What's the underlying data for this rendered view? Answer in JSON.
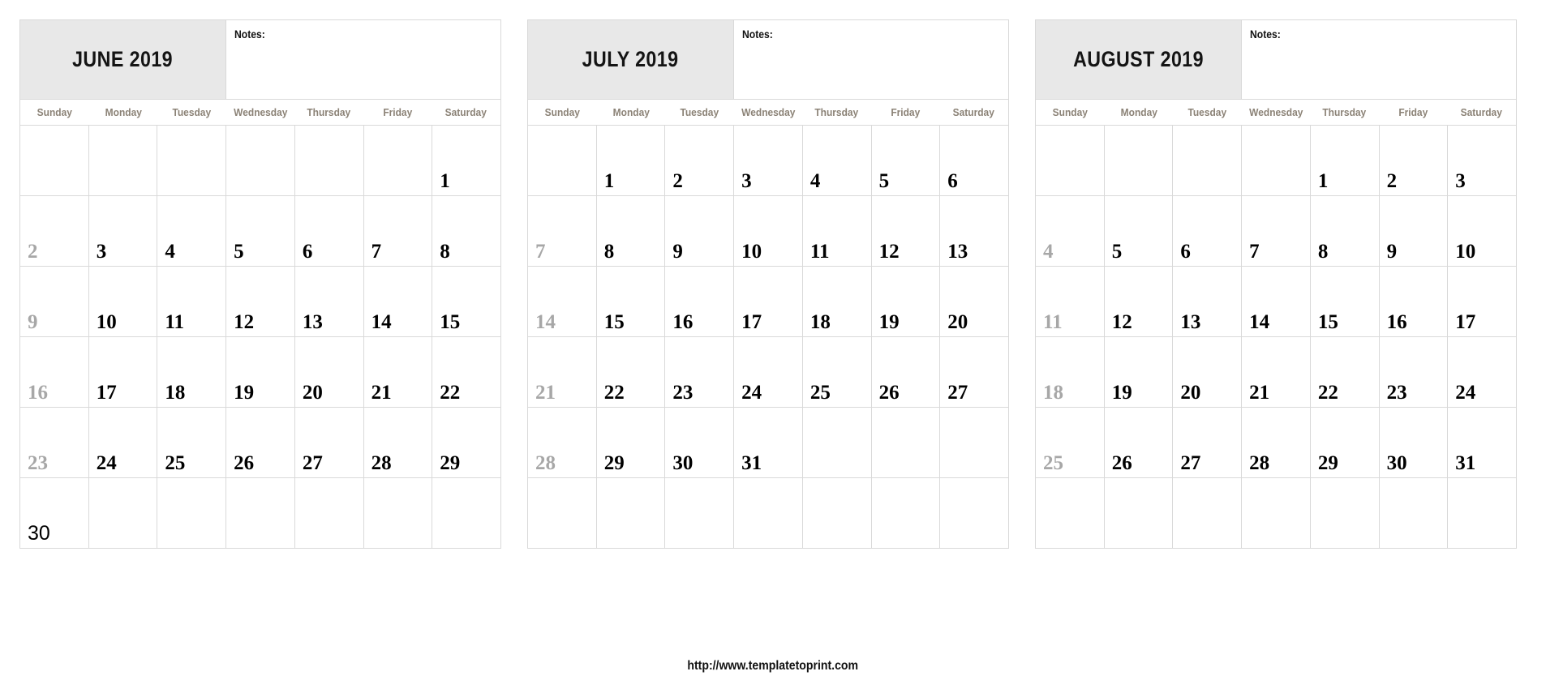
{
  "site": {
    "footer_url": "http://www.templatetoprint.com"
  },
  "labels": {
    "notes": "Notes:"
  },
  "weekdays": [
    "Sunday",
    "Monday",
    "Tuesday",
    "Wednesday",
    "Thursday",
    "Friday",
    "Saturday"
  ],
  "colors": {
    "title_background": "#e8e8e8",
    "grid_border": "#d9d9d9",
    "weekday_text": "#8b8276",
    "sunday_text": "#a7a7a7",
    "weekday_text_dark": "#000000",
    "page_background": "#ffffff"
  },
  "calendars": [
    {
      "id": "june-2019",
      "title": "JUNE 2019",
      "month": "June",
      "year": "2019",
      "notes_value": "",
      "rows": 6,
      "weeks": [
        [
          "",
          "",
          "",
          "",
          "",
          "",
          "1"
        ],
        [
          "2",
          "3",
          "4",
          "5",
          "6",
          "7",
          "8"
        ],
        [
          "9",
          "10",
          "11",
          "12",
          "13",
          "14",
          "15"
        ],
        [
          "16",
          "17",
          "18",
          "19",
          "20",
          "21",
          "22"
        ],
        [
          "23",
          "24",
          "25",
          "26",
          "27",
          "28",
          "29"
        ],
        [
          "30",
          "",
          "",
          "",
          "",
          "",
          ""
        ]
      ]
    },
    {
      "id": "july-2019",
      "title": "JULY 2019",
      "month": "July",
      "year": "2019",
      "notes_value": "",
      "rows": 6,
      "weeks": [
        [
          "",
          "1",
          "2",
          "3",
          "4",
          "5",
          "6"
        ],
        [
          "7",
          "8",
          "9",
          "10",
          "11",
          "12",
          "13"
        ],
        [
          "14",
          "15",
          "16",
          "17",
          "18",
          "19",
          "20"
        ],
        [
          "21",
          "22",
          "23",
          "24",
          "25",
          "26",
          "27"
        ],
        [
          "28",
          "29",
          "30",
          "31",
          "",
          "",
          ""
        ],
        [
          "",
          "",
          "",
          "",
          "",
          "",
          ""
        ]
      ]
    },
    {
      "id": "august-2019",
      "title": "AUGUST 2019",
      "month": "August",
      "year": "2019",
      "notes_value": "",
      "rows": 6,
      "weeks": [
        [
          "",
          "",
          "",
          "",
          "1",
          "2",
          "3"
        ],
        [
          "4",
          "5",
          "6",
          "7",
          "8",
          "9",
          "10"
        ],
        [
          "11",
          "12",
          "13",
          "14",
          "15",
          "16",
          "17"
        ],
        [
          "18",
          "19",
          "20",
          "21",
          "22",
          "23",
          "24"
        ],
        [
          "25",
          "26",
          "27",
          "28",
          "29",
          "30",
          "31"
        ],
        [
          "",
          "",
          "",
          "",
          "",
          "",
          ""
        ]
      ]
    }
  ]
}
